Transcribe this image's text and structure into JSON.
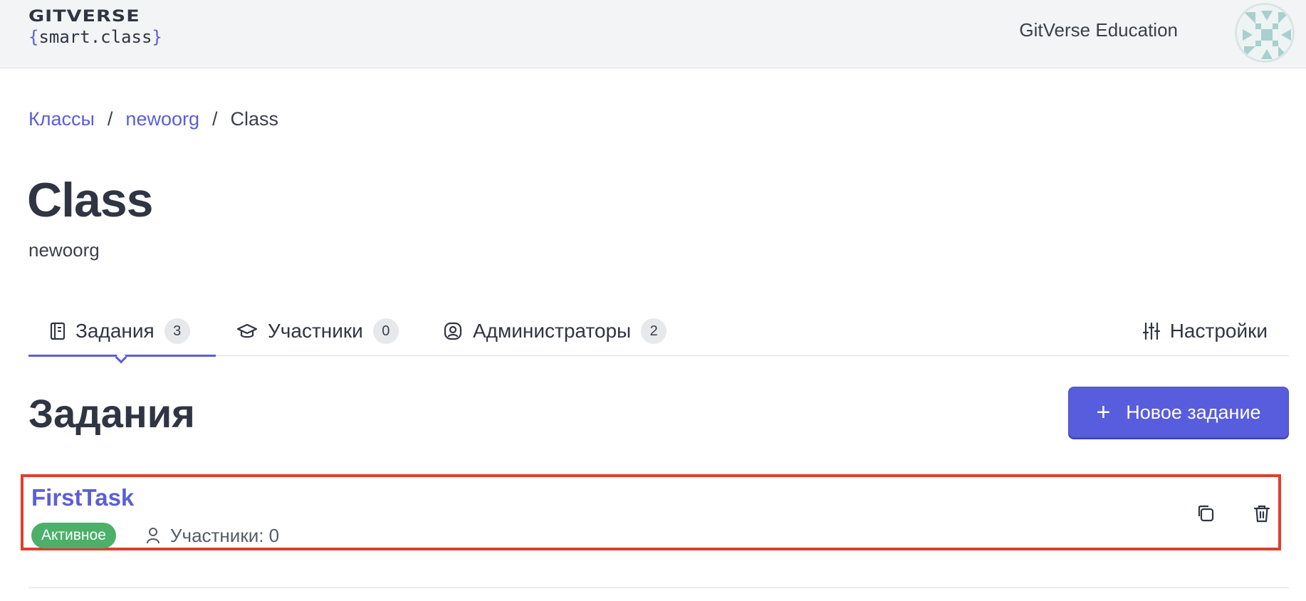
{
  "header": {
    "logo_top": "GITVERSE",
    "logo_open_brace": "{",
    "logo_text": "smart.class",
    "logo_close_brace": "}",
    "org_name": "GitVerse Education"
  },
  "breadcrumb": {
    "items": [
      "Классы",
      "newoorg",
      "Class"
    ],
    "separator": "/"
  },
  "page": {
    "title": "Class",
    "subtitle": "newoorg"
  },
  "tabs": [
    {
      "label": "Задания",
      "count": "3",
      "icon": "book-icon",
      "active": true
    },
    {
      "label": "Участники",
      "count": "0",
      "icon": "graduation-cap-icon",
      "active": false
    },
    {
      "label": "Администраторы",
      "count": "2",
      "icon": "user-circle-icon",
      "active": false
    }
  ],
  "settings_tab": {
    "label": "Настройки",
    "icon": "sliders-icon"
  },
  "section": {
    "title": "Задания",
    "new_button_icon": "+",
    "new_button_label": "Новое задание"
  },
  "tasks": [
    {
      "name": "FirstTask",
      "status": "Активное",
      "participants_label": "Участники: 0"
    }
  ],
  "colors": {
    "accent": "#5a5fd6",
    "button": "#575ddc",
    "status_active": "#4caf6a",
    "highlight_border": "#e03e2d",
    "header_bg": "#f3f4f6",
    "text": "#2f3542"
  }
}
